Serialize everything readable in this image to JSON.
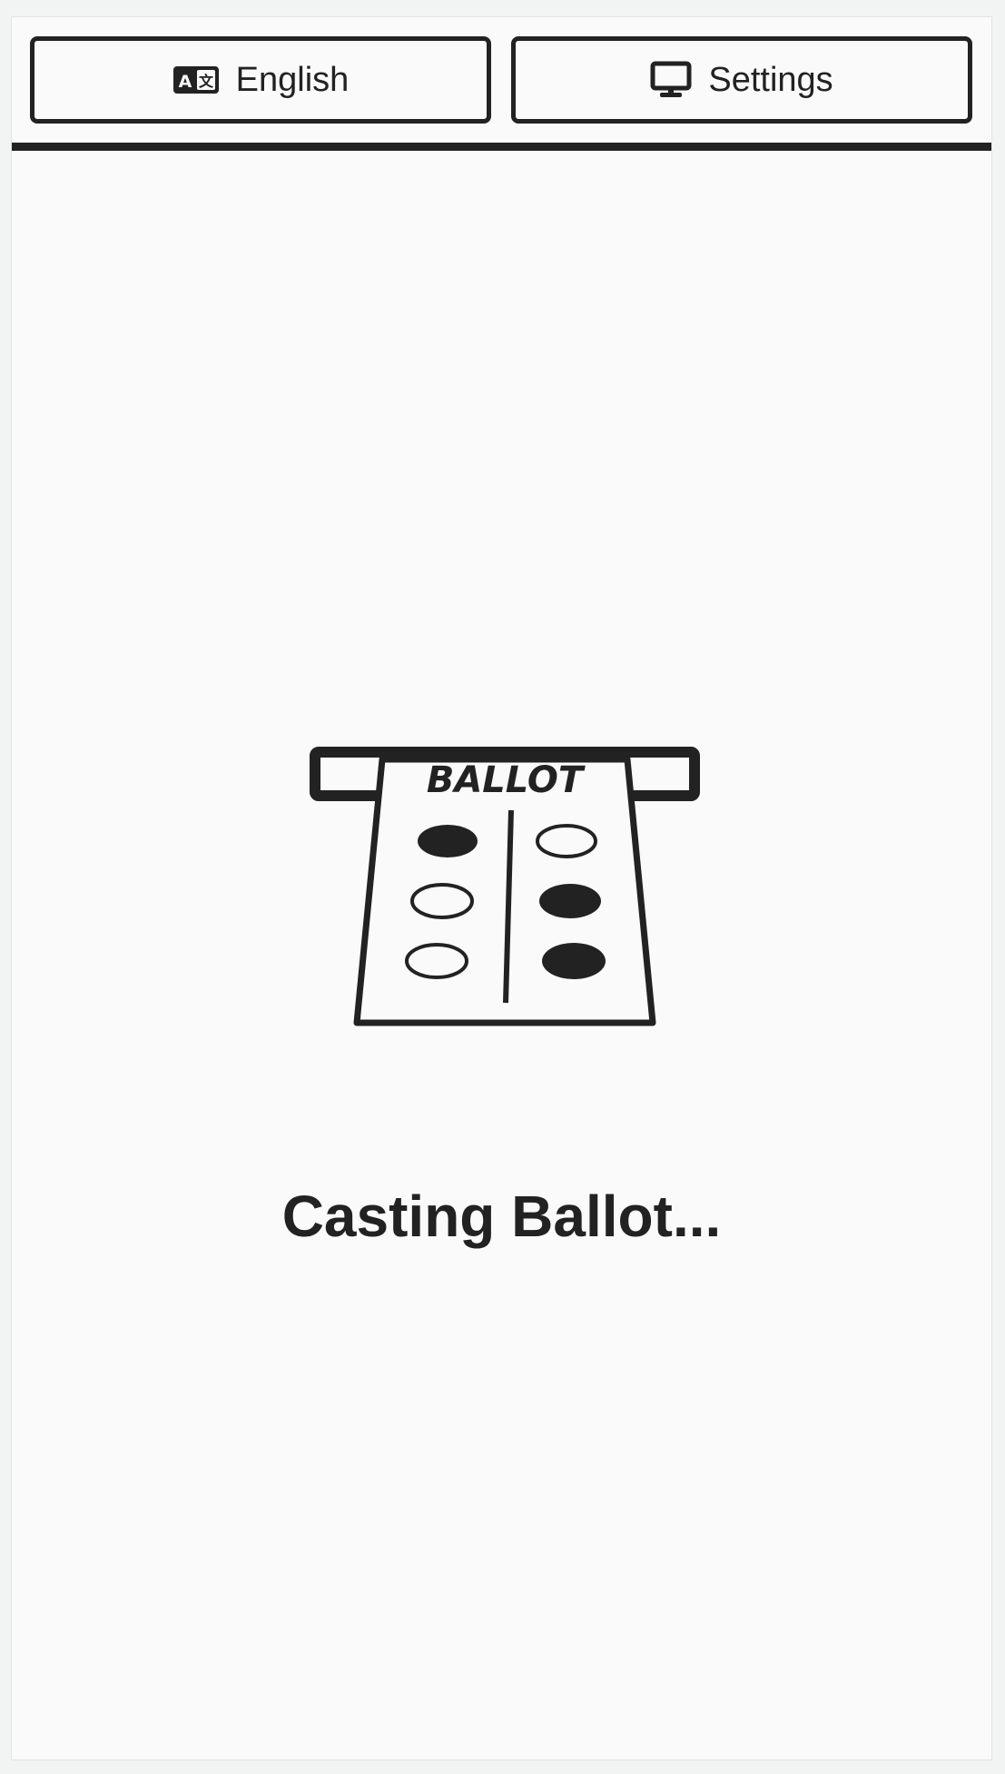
{
  "header": {
    "language_button": {
      "label": "English",
      "icon": "language-icon"
    },
    "settings_button": {
      "label": "Settings",
      "icon": "monitor-icon"
    }
  },
  "main": {
    "ballot_illustration": {
      "label": "BALLOT",
      "icon": "ballot-box-icon"
    },
    "status_message": "Casting Ballot..."
  },
  "colors": {
    "foreground": "#222222",
    "background": "#fafafa",
    "page_border": "#f2f3f3"
  }
}
